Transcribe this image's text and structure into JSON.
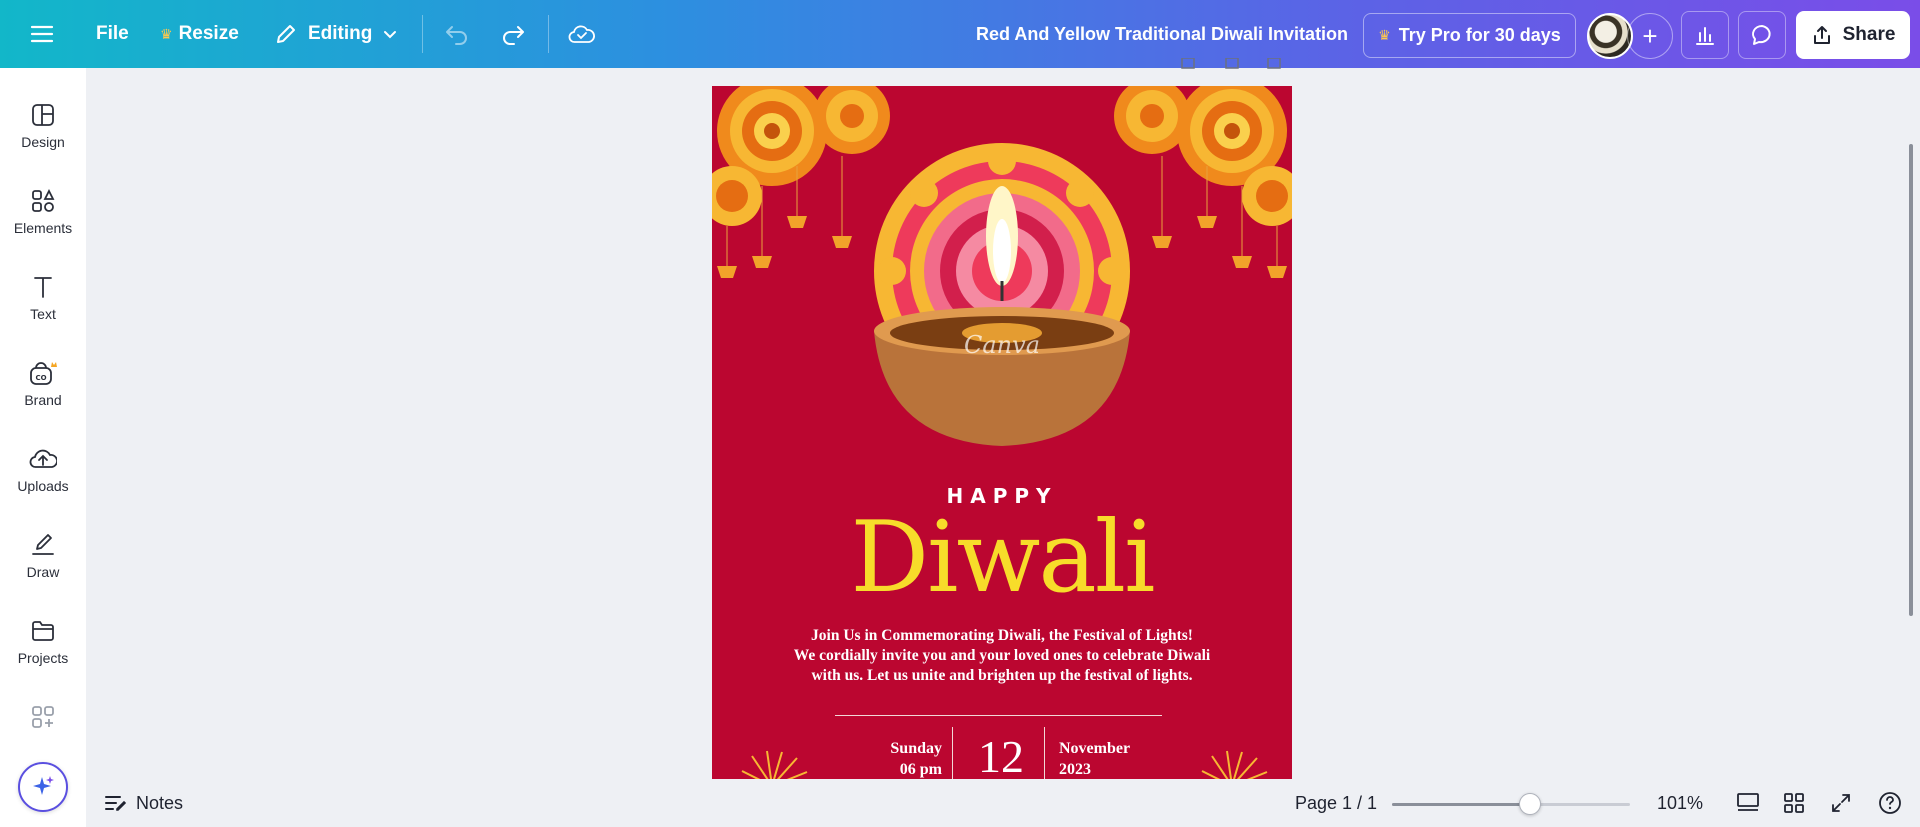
{
  "topbar": {
    "file_label": "File",
    "resize_label": "Resize",
    "editing_label": "Editing",
    "document_title": "Red And Yellow Traditional Diwali Invitation",
    "pro_label": "Try Pro for 30 days",
    "share_label": "Share"
  },
  "sidebar": {
    "items": [
      {
        "label": "Design",
        "icon": "design-icon"
      },
      {
        "label": "Elements",
        "icon": "elements-icon"
      },
      {
        "label": "Text",
        "icon": "text-icon"
      },
      {
        "label": "Brand",
        "icon": "brand-icon"
      },
      {
        "label": "Uploads",
        "icon": "uploads-icon"
      },
      {
        "label": "Draw",
        "icon": "draw-icon"
      },
      {
        "label": "Projects",
        "icon": "projects-icon"
      }
    ]
  },
  "canvas": {
    "watermark": "Canva",
    "happy": "HAPPY",
    "title": "Diwali",
    "invite_lines": [
      "Join Us in Commemorating Diwali, the Festival of Lights!",
      "We cordially invite you and your loved ones to celebrate Diwali",
      "with us. Let us unite and brighten up the festival of lights."
    ],
    "day": "Sunday",
    "time": "06 pm",
    "date": "12",
    "month": "November",
    "year": "2023",
    "colors": {
      "background": "#bb0630",
      "title": "#f7dc2a"
    }
  },
  "bottombar": {
    "notes_label": "Notes",
    "page_label": "Page 1 / 1",
    "zoom_label": "101%",
    "zoom_fraction": 0.58
  }
}
